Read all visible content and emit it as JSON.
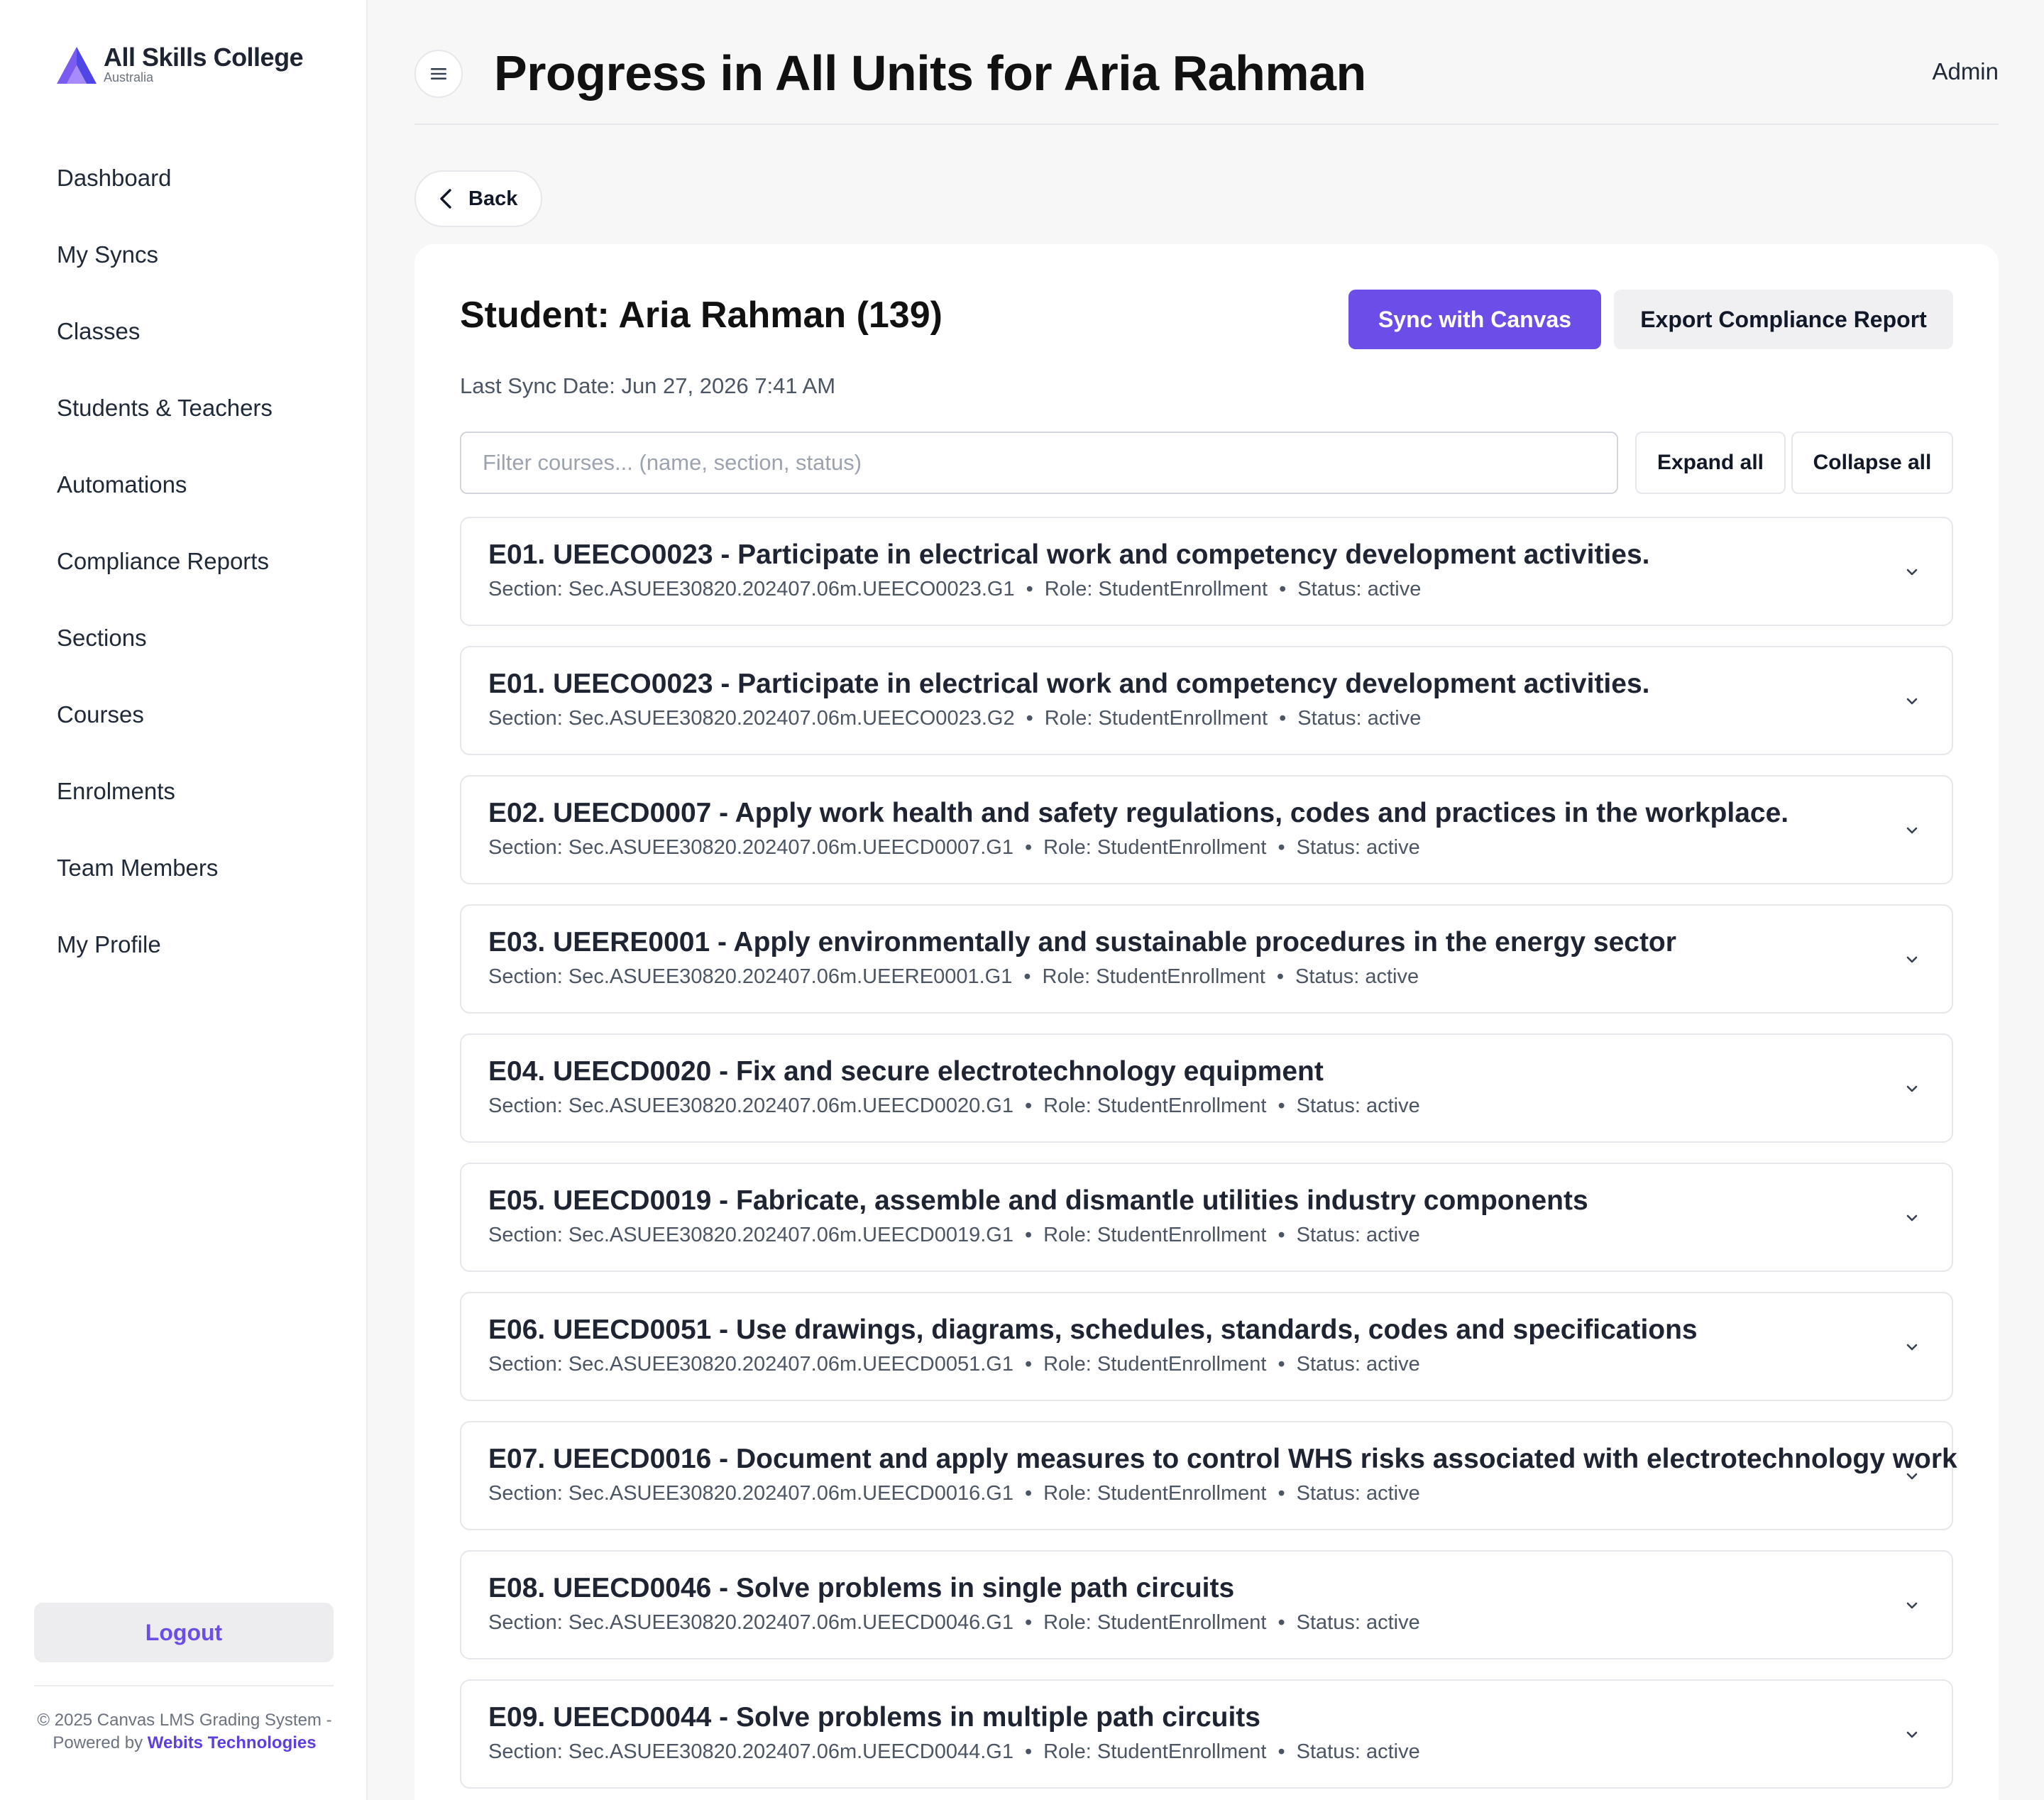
{
  "brand": {
    "name": "All Skills College",
    "sub": "Australia",
    "colors": {
      "primary": "#6d4de8",
      "secondary": "#4f46e5"
    }
  },
  "sidebar": {
    "items": [
      {
        "label": "Dashboard"
      },
      {
        "label": "My Syncs"
      },
      {
        "label": "Classes"
      },
      {
        "label": "Students & Teachers"
      },
      {
        "label": "Automations"
      },
      {
        "label": "Compliance Reports"
      },
      {
        "label": "Sections"
      },
      {
        "label": "Courses"
      },
      {
        "label": "Enrolments"
      },
      {
        "label": "Team Members"
      },
      {
        "label": "My Profile"
      }
    ],
    "logout": "Logout",
    "footer_text": "© 2025 Canvas LMS Grading System - Powered by",
    "footer_link": "Webits Technologies"
  },
  "header": {
    "menu_icon": "hamburger-icon",
    "title": "Progress in All Units for Aria Rahman",
    "user": "Admin"
  },
  "back": {
    "label": "Back",
    "icon": "chevron-left-icon"
  },
  "student": {
    "title": "Student: Aria Rahman (139)",
    "last_sync": "Last Sync Date: Jun 27, 2026 7:41 AM",
    "sync_button": "Sync  with Canvas",
    "export_button": "Export Compliance Report"
  },
  "filter": {
    "placeholder": "Filter courses... (name, section, status)",
    "value": ""
  },
  "controls": {
    "expand_all": "Expand all",
    "collapse_all": "Collapse all"
  },
  "courses": [
    {
      "title": "E01. UEECO0023 - Participate in electrical work and competency development activities.",
      "section": "Section: Sec.ASUEE30820.202407.06m.UEECO0023.G1",
      "role": "Role: StudentEnrollment",
      "status": "Status: active"
    },
    {
      "title": "E01. UEECO0023 - Participate in electrical work and competency development activities.",
      "section": "Section: Sec.ASUEE30820.202407.06m.UEECO0023.G2",
      "role": "Role: StudentEnrollment",
      "status": "Status: active"
    },
    {
      "title": "E02. UEECD0007 - Apply work health and safety regulations, codes and practices in the workplace.",
      "section": "Section: Sec.ASUEE30820.202407.06m.UEECD0007.G1",
      "role": "Role: StudentEnrollment",
      "status": "Status: active"
    },
    {
      "title": "E03. UEERE0001 - Apply environmentally and sustainable procedures in the energy sector",
      "section": "Section: Sec.ASUEE30820.202407.06m.UEERE0001.G1",
      "role": "Role: StudentEnrollment",
      "status": "Status: active"
    },
    {
      "title": "E04. UEECD0020 - Fix and secure electrotechnology equipment",
      "section": "Section: Sec.ASUEE30820.202407.06m.UEECD0020.G1",
      "role": "Role: StudentEnrollment",
      "status": "Status: active"
    },
    {
      "title": "E05. UEECD0019 - Fabricate, assemble and dismantle utilities industry components",
      "section": "Section: Sec.ASUEE30820.202407.06m.UEECD0019.G1",
      "role": "Role: StudentEnrollment",
      "status": "Status: active"
    },
    {
      "title": "E06. UEECD0051 - Use drawings, diagrams, schedules, standards, codes and specifications",
      "section": "Section: Sec.ASUEE30820.202407.06m.UEECD0051.G1",
      "role": "Role: StudentEnrollment",
      "status": "Status: active"
    },
    {
      "title": "E07. UEECD0016 - Document and apply measures to control WHS risks associated with electrotechnology work",
      "section": "Section: Sec.ASUEE30820.202407.06m.UEECD0016.G1",
      "role": "Role: StudentEnrollment",
      "status": "Status: active"
    },
    {
      "title": "E08. UEECD0046 - Solve problems in single path circuits",
      "section": "Section: Sec.ASUEE30820.202407.06m.UEECD0046.G1",
      "role": "Role: StudentEnrollment",
      "status": "Status: active"
    },
    {
      "title": "E09. UEECD0044 - Solve problems in multiple path circuits",
      "section": "Section: Sec.ASUEE30820.202407.06m.UEECD0044.G1",
      "role": "Role: StudentEnrollment",
      "status": "Status: active"
    }
  ]
}
